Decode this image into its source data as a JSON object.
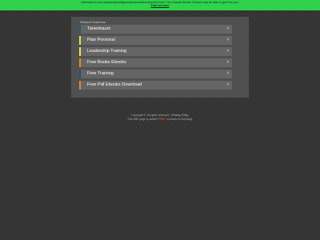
{
  "topbar": {
    "line1": "Interested in principlesandparadigmsofpersonaldevelopment.com? Our Domain Broker Service may be able to get it for you.",
    "line2": "Find out here"
  },
  "panel": {
    "title": "Related Searches",
    "items": [
      {
        "label": "Tanenbaum",
        "accent": "#1a5e8a"
      },
      {
        "label": "Plan Personal",
        "accent": "#d8e84a"
      },
      {
        "label": "Leadership Training",
        "accent": "#e8e84a"
      },
      {
        "label": "Free Books Ebooks",
        "accent": "#e88a2a"
      },
      {
        "label": "Free Training",
        "accent": "#2a4a8a"
      },
      {
        "label": "Free Pdf Ebooks Download",
        "accent": "#e88a2a"
      }
    ]
  },
  "footer": {
    "copyright": "Copyright ©. All rights reserved.",
    "separator": "|",
    "privacy": "Privacy Policy",
    "line2_pre": "This Web page is parked",
    "line2_free": "FREE",
    "line2_post": ", courtesy of GoDaddy."
  },
  "icons": {
    "chevron": "chevron-right-icon"
  }
}
